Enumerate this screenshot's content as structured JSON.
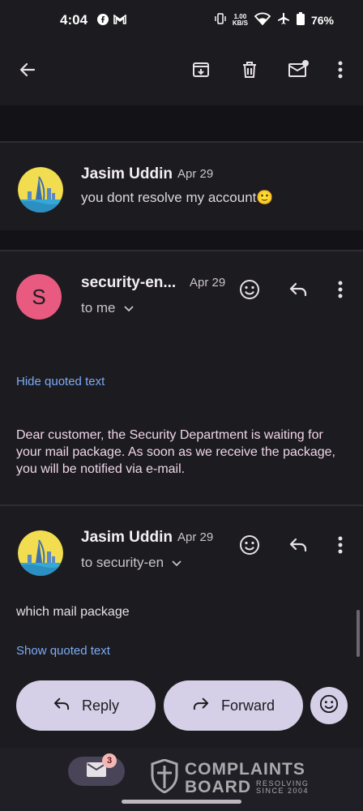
{
  "status_bar": {
    "time": "4:04",
    "speed_value": "1.00",
    "speed_unit": "KB/S",
    "battery": "76%"
  },
  "app_bar": {
    "back_icon": "arrow-back-icon",
    "archive_icon": "archive-icon",
    "delete_icon": "trash-icon",
    "mark_unread_icon": "mark-unread-icon",
    "more_icon": "more-vert-icon"
  },
  "thread": [
    {
      "sender": "Jasim Uddin",
      "date": "Apr 29",
      "snippet": "you dont resolve my account🙂",
      "avatar": "skyline-icon"
    },
    {
      "sender": "security-en...",
      "date": "Apr 29",
      "recipient": "to me",
      "avatar_letter": "S",
      "quoted_link": "Hide quoted text",
      "body": "Dear customer, the Security Department is waiting for your mail package. As soon as we receive the package, you will be notified via e-mail."
    },
    {
      "sender": "Jasim Uddin",
      "date": "Apr 29",
      "recipient": "to security-en",
      "avatar": "skyline-icon",
      "body": "which mail package",
      "quoted_link": "Show quoted text"
    }
  ],
  "actions": {
    "reply_label": "Reply",
    "forward_label": "Forward"
  },
  "nav": {
    "mail_badge": "3"
  },
  "watermark": {
    "line1": "COMPLAINTS",
    "line2": "BOARD",
    "line3": "RESOLVING",
    "line4": "SINCE 2004"
  },
  "colors": {
    "background": "#1c1b1f",
    "link": "#7cacf8",
    "pill": "#d5d0e7",
    "avatar_s": "#e85a7f"
  }
}
